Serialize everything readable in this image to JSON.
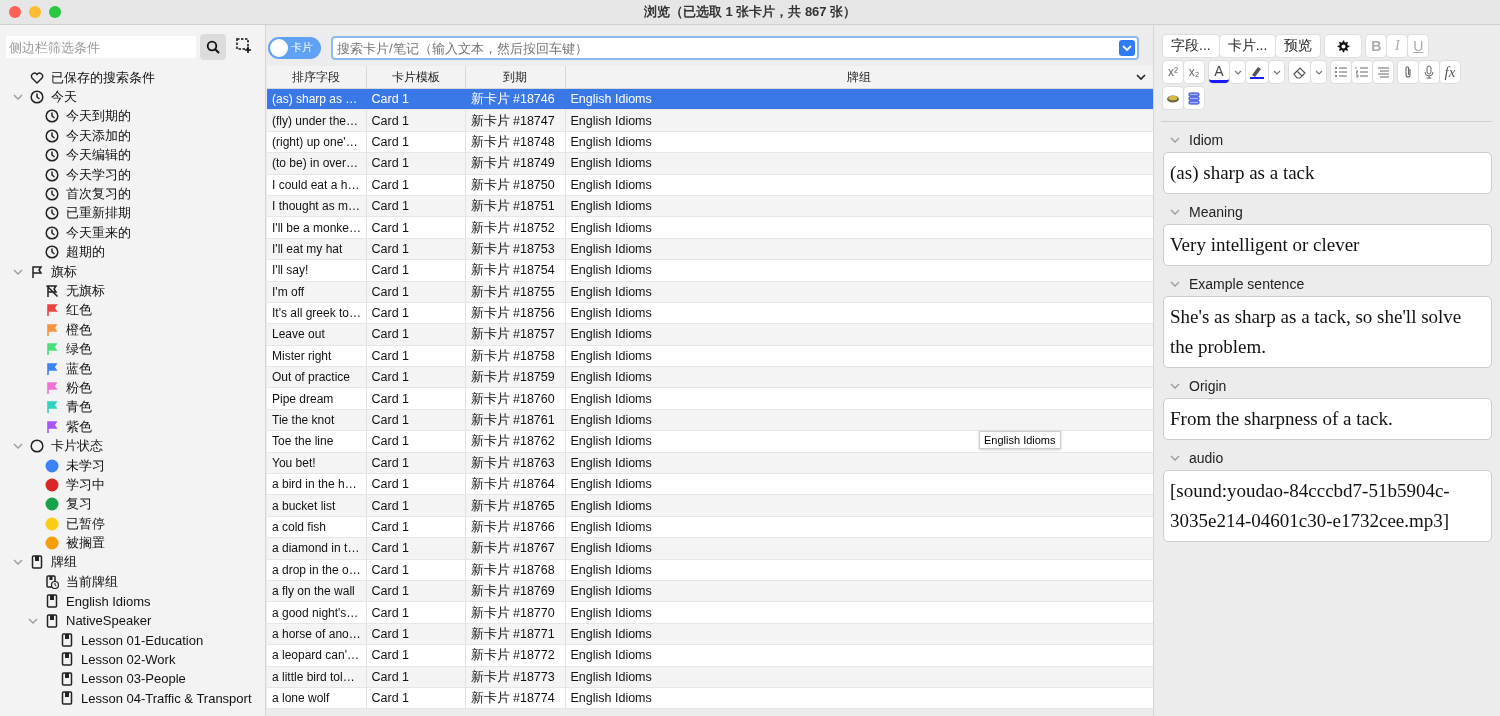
{
  "window": {
    "title": "浏览（已选取 1 张卡片，共 867 张）"
  },
  "sidebar": {
    "filter_placeholder": "侧边栏筛选条件",
    "items": [
      {
        "label": "已保存的搜索条件",
        "kind": "heart"
      },
      {
        "label": "今天",
        "kind": "clock",
        "expanded": true,
        "children": [
          {
            "label": "今天到期的",
            "kind": "clock"
          },
          {
            "label": "今天添加的",
            "kind": "clock"
          },
          {
            "label": "今天编辑的",
            "kind": "clock"
          },
          {
            "label": "今天学习的",
            "kind": "clock"
          },
          {
            "label": "首次复习的",
            "kind": "clock"
          },
          {
            "label": "已重新排期",
            "kind": "clock"
          },
          {
            "label": "今天重来的",
            "kind": "clock"
          },
          {
            "label": "超期的",
            "kind": "clock"
          }
        ]
      },
      {
        "label": "旗标",
        "kind": "flag",
        "expanded": true,
        "children": [
          {
            "label": "无旗标",
            "kind": "flag-off"
          },
          {
            "label": "红色",
            "kind": "flag",
            "color": "#f04444"
          },
          {
            "label": "橙色",
            "kind": "flag",
            "color": "#fb923c"
          },
          {
            "label": "绿色",
            "kind": "flag",
            "color": "#4ade80"
          },
          {
            "label": "蓝色",
            "kind": "flag",
            "color": "#3b82f6"
          },
          {
            "label": "粉色",
            "kind": "flag",
            "color": "#f472d6"
          },
          {
            "label": "青色",
            "kind": "flag",
            "color": "#2dd4bf"
          },
          {
            "label": "紫色",
            "kind": "flag",
            "color": "#a855f7"
          }
        ]
      },
      {
        "label": "卡片状态",
        "kind": "circle",
        "expanded": true,
        "children": [
          {
            "label": "未学习",
            "kind": "dot",
            "color": "#3b82f6"
          },
          {
            "label": "学习中",
            "kind": "dot",
            "color": "#dc2626"
          },
          {
            "label": "复习",
            "kind": "dot",
            "color": "#16a34a"
          },
          {
            "label": "已暂停",
            "kind": "dot",
            "color": "#facc15"
          },
          {
            "label": "被搁置",
            "kind": "dot",
            "color": "#f59e0b"
          }
        ]
      },
      {
        "label": "牌组",
        "kind": "deck",
        "expanded": true,
        "children": [
          {
            "label": "当前牌组",
            "kind": "deck-clock"
          },
          {
            "label": "English Idioms",
            "kind": "deck"
          },
          {
            "label": "NativeSpeaker",
            "kind": "deck",
            "expanded": true,
            "children": [
              {
                "label": "Lesson 01-Education",
                "kind": "deck"
              },
              {
                "label": "Lesson 02-Work",
                "kind": "deck"
              },
              {
                "label": "Lesson 03-People",
                "kind": "deck"
              },
              {
                "label": "Lesson 04-Traffic & Transport",
                "kind": "deck"
              }
            ]
          }
        ]
      }
    ]
  },
  "toggle": {
    "label": "卡片"
  },
  "search": {
    "placeholder": "搜索卡片/笔记（输入文本，然后按回车键）"
  },
  "table": {
    "columns": [
      "排序字段",
      "卡片模板",
      "到期",
      "牌组"
    ],
    "rows": [
      {
        "sort_field": "(as) sharp as …",
        "template": "Card 1",
        "due": "新卡片 #18746",
        "deck": "English Idioms",
        "selected": true
      },
      {
        "sort_field": "(fly) under the…",
        "template": "Card 1",
        "due": "新卡片 #18747",
        "deck": "English Idioms",
        "selected": false
      },
      {
        "sort_field": "(right) up one'…",
        "template": "Card 1",
        "due": "新卡片 #18748",
        "deck": "English Idioms",
        "selected": false
      },
      {
        "sort_field": "(to be) in over…",
        "template": "Card 1",
        "due": "新卡片 #18749",
        "deck": "English Idioms",
        "selected": false
      },
      {
        "sort_field": "I could eat a h…",
        "template": "Card 1",
        "due": "新卡片 #18750",
        "deck": "English Idioms",
        "selected": false
      },
      {
        "sort_field": "I thought as m…",
        "template": "Card 1",
        "due": "新卡片 #18751",
        "deck": "English Idioms",
        "selected": false
      },
      {
        "sort_field": "I'll be a monke…",
        "template": "Card 1",
        "due": "新卡片 #18752",
        "deck": "English Idioms",
        "selected": false
      },
      {
        "sort_field": "I'll eat my hat",
        "template": "Card 1",
        "due": "新卡片 #18753",
        "deck": "English Idioms",
        "selected": false
      },
      {
        "sort_field": "I'll say!",
        "template": "Card 1",
        "due": "新卡片 #18754",
        "deck": "English Idioms",
        "selected": false
      },
      {
        "sort_field": "I'm off",
        "template": "Card 1",
        "due": "新卡片 #18755",
        "deck": "English Idioms",
        "selected": false
      },
      {
        "sort_field": "It's all greek to…",
        "template": "Card 1",
        "due": "新卡片 #18756",
        "deck": "English Idioms",
        "selected": false
      },
      {
        "sort_field": "Leave out",
        "template": "Card 1",
        "due": "新卡片 #18757",
        "deck": "English Idioms",
        "selected": false
      },
      {
        "sort_field": "Mister right",
        "template": "Card 1",
        "due": "新卡片 #18758",
        "deck": "English Idioms",
        "selected": false
      },
      {
        "sort_field": "Out of practice",
        "template": "Card 1",
        "due": "新卡片 #18759",
        "deck": "English Idioms",
        "selected": false
      },
      {
        "sort_field": "Pipe dream",
        "template": "Card 1",
        "due": "新卡片 #18760",
        "deck": "English Idioms",
        "selected": false
      },
      {
        "sort_field": "Tie the knot",
        "template": "Card 1",
        "due": "新卡片 #18761",
        "deck": "English Idioms",
        "selected": false
      },
      {
        "sort_field": "Toe the line",
        "template": "Card 1",
        "due": "新卡片 #18762",
        "deck": "English Idioms",
        "selected": false
      },
      {
        "sort_field": "You bet!",
        "template": "Card 1",
        "due": "新卡片 #18763",
        "deck": "English Idioms",
        "selected": false
      },
      {
        "sort_field": "a bird in the h…",
        "template": "Card 1",
        "due": "新卡片 #18764",
        "deck": "English Idioms",
        "selected": false
      },
      {
        "sort_field": "a bucket list",
        "template": "Card 1",
        "due": "新卡片 #18765",
        "deck": "English Idioms",
        "selected": false
      },
      {
        "sort_field": "a cold fish",
        "template": "Card 1",
        "due": "新卡片 #18766",
        "deck": "English Idioms",
        "selected": false
      },
      {
        "sort_field": "a diamond in t…",
        "template": "Card 1",
        "due": "新卡片 #18767",
        "deck": "English Idioms",
        "selected": false
      },
      {
        "sort_field": "a drop in the o…",
        "template": "Card 1",
        "due": "新卡片 #18768",
        "deck": "English Idioms",
        "selected": false
      },
      {
        "sort_field": "a fly on the wall",
        "template": "Card 1",
        "due": "新卡片 #18769",
        "deck": "English Idioms",
        "selected": false
      },
      {
        "sort_field": "a good night's…",
        "template": "Card 1",
        "due": "新卡片 #18770",
        "deck": "English Idioms",
        "selected": false
      },
      {
        "sort_field": "a horse of ano…",
        "template": "Card 1",
        "due": "新卡片 #18771",
        "deck": "English Idioms",
        "selected": false
      },
      {
        "sort_field": "a leopard can'…",
        "template": "Card 1",
        "due": "新卡片 #18772",
        "deck": "English Idioms",
        "selected": false
      },
      {
        "sort_field": "a little bird tol…",
        "template": "Card 1",
        "due": "新卡片 #18773",
        "deck": "English Idioms",
        "selected": false
      },
      {
        "sort_field": "a lone wolf",
        "template": "Card 1",
        "due": "新卡片 #18774",
        "deck": "English Idioms",
        "selected": false
      }
    ]
  },
  "tooltip": {
    "text": "English Idioms"
  },
  "editor": {
    "buttons": [
      {
        "label": "字段..."
      },
      {
        "label": "卡片..."
      },
      {
        "label": "预览"
      }
    ],
    "format": [
      {
        "label": "B",
        "disabled": true
      },
      {
        "label": "I",
        "disabled": true
      },
      {
        "label": "U",
        "disabled": true
      }
    ],
    "script": [
      {
        "label": "x²"
      },
      {
        "label": "x₂"
      }
    ],
    "text_color": {
      "label": "A"
    },
    "function": {
      "label": "fx"
    },
    "fields": [
      {
        "name": "Idiom",
        "value": "(as) sharp as a tack",
        "expanded": true
      },
      {
        "name": "Meaning",
        "value": "Very intelligent or clever",
        "expanded": true
      },
      {
        "name": "Example sentence",
        "value": "She's as sharp as a tack, so she'll solve the problem.",
        "expanded": true
      },
      {
        "name": "Origin",
        "value": "From the sharpness of a tack.",
        "expanded": true
      },
      {
        "name": "audio",
        "value": "[sound:youdao-84cccbd7-51b5904c-3035e214-04601c30-e1732cee.mp3]",
        "expanded": true
      }
    ]
  }
}
